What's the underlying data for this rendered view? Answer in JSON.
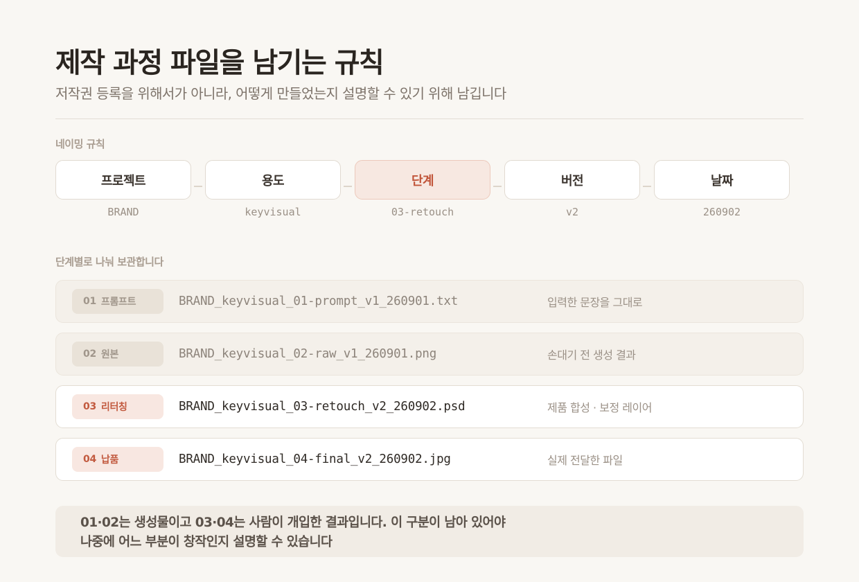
{
  "header": {
    "title": "제작 과정 파일을 남기는 규칙",
    "subtitle": "저작권 등록을 위해서가 아니라, 어떻게 만들었는지 설명할 수 있기 위해 남깁니다"
  },
  "naming": {
    "label": "네이밍 규칙",
    "parts": [
      {
        "name": "프로젝트",
        "example": "BRAND"
      },
      {
        "name": "용도",
        "example": "keyvisual"
      },
      {
        "name": "단계",
        "example": "03-retouch",
        "highlight": true
      },
      {
        "name": "버전",
        "example": "v2"
      },
      {
        "name": "날짜",
        "example": "260902"
      }
    ]
  },
  "stages": {
    "label": "단계별로 나눠 보관합니다",
    "files": [
      {
        "num": "01",
        "stage": "프롬프트",
        "filename": "BRAND_keyvisual_01-prompt_v1_260901.txt",
        "description": "입력한 문장을 그대로",
        "human": false
      },
      {
        "num": "02",
        "stage": "원본",
        "filename": "BRAND_keyvisual_02-raw_v1_260901.png",
        "description": "손대기 전 생성 결과",
        "human": false
      },
      {
        "num": "03",
        "stage": "리터칭",
        "filename": "BRAND_keyvisual_03-retouch_v2_260902.psd",
        "description": "제품 합성 · 보정 레이어",
        "human": true
      },
      {
        "num": "04",
        "stage": "납품",
        "filename": "BRAND_keyvisual_04-final_v2_260902.jpg",
        "description": "실제 전달한 파일",
        "human": true
      }
    ]
  },
  "note": {
    "line1": "01·02는 생성물이고 03·04는 사람이 개입한 결과입니다. 이 구분이 남아 있어야",
    "line2": "나중에 어느 부분이 창작인지 설명할 수 있습니다"
  },
  "colors": {
    "background": "#f9f7f3",
    "accent": "#c1553a",
    "accent_bg": "#f7e8e1"
  }
}
